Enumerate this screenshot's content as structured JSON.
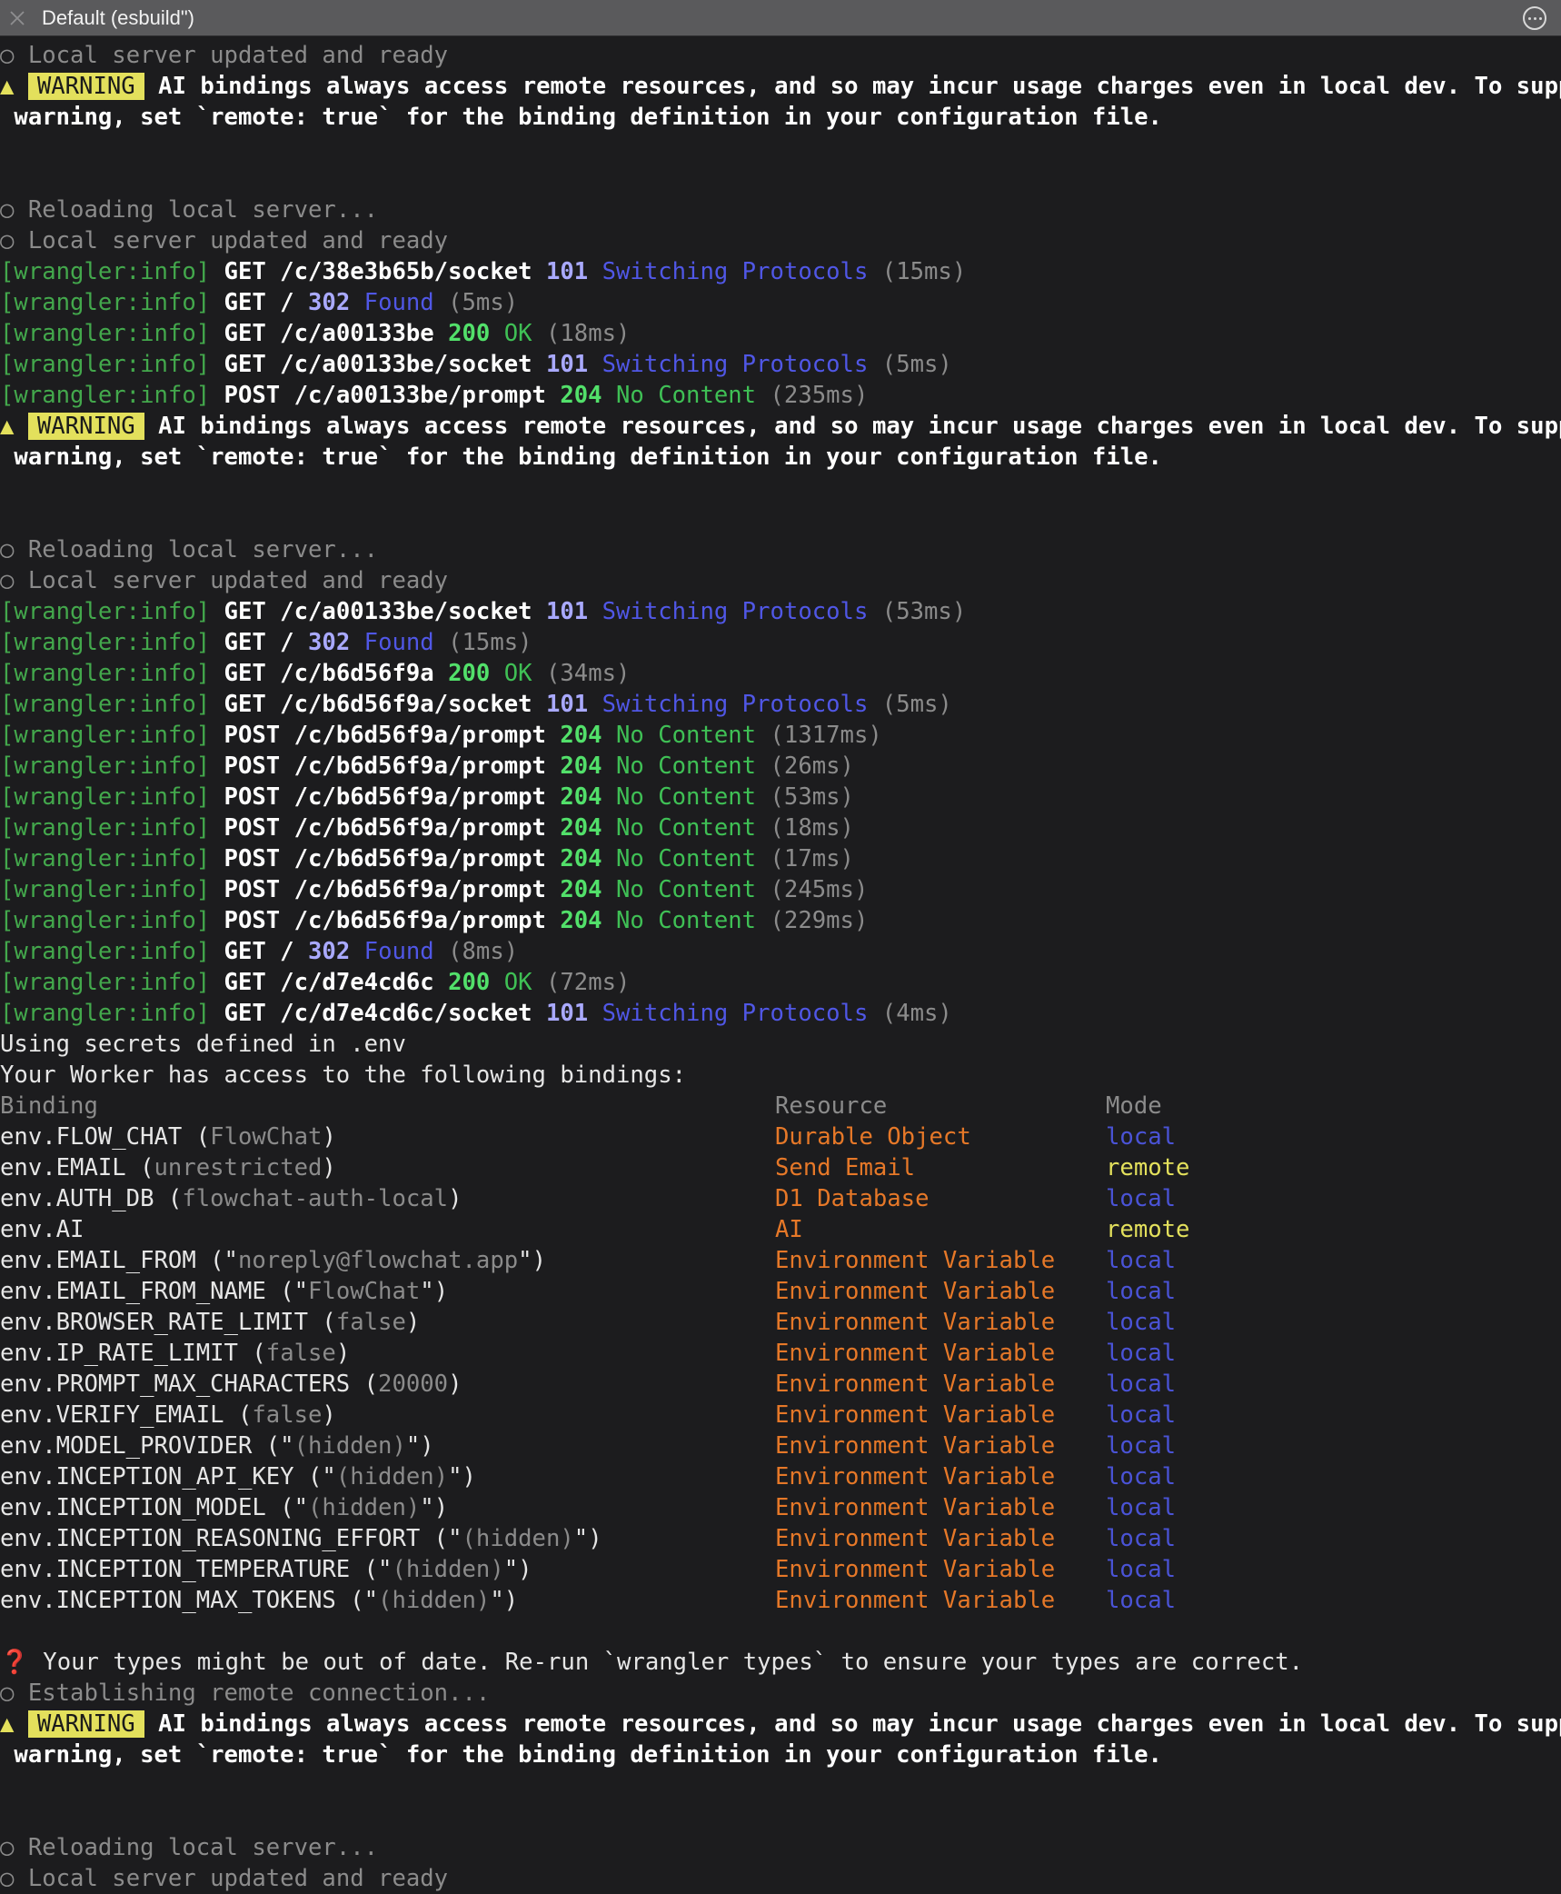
{
  "window": {
    "title": "Default (esbuild\")"
  },
  "log": {
    "updated": "Local server updated and ready",
    "reloading": "Reloading local server...",
    "establishing": "Establishing remote connection...",
    "circle": "○",
    "warning_triangle": "▲",
    "warning_badge": "WARNING",
    "warning_line1": "AI bindings always access remote resources, and so may incur usage charges even in local dev. To suppress this",
    "warning_line2": "warning, set `remote: true` for the binding definition in your configuration file.",
    "prefix": "[wrangler:info]",
    "requests": [
      {
        "method": "GET",
        "path": "/c/38e3b65b/socket",
        "code": "101",
        "text": "Switching Protocols",
        "time": "(15ms)"
      },
      {
        "method": "GET",
        "path": "/",
        "code": "302",
        "text": "Found",
        "time": "(5ms)"
      },
      {
        "method": "GET",
        "path": "/c/a00133be",
        "code": "200",
        "text": "OK",
        "time": "(18ms)"
      },
      {
        "method": "GET",
        "path": "/c/a00133be/socket",
        "code": "101",
        "text": "Switching Protocols",
        "time": "(5ms)"
      },
      {
        "method": "POST",
        "path": "/c/a00133be/prompt",
        "code": "204",
        "text": "No Content",
        "time": "(235ms)"
      },
      {
        "method": "GET",
        "path": "/c/a00133be/socket",
        "code": "101",
        "text": "Switching Protocols",
        "time": "(53ms)"
      },
      {
        "method": "GET",
        "path": "/",
        "code": "302",
        "text": "Found",
        "time": "(15ms)"
      },
      {
        "method": "GET",
        "path": "/c/b6d56f9a",
        "code": "200",
        "text": "OK",
        "time": "(34ms)"
      },
      {
        "method": "GET",
        "path": "/c/b6d56f9a/socket",
        "code": "101",
        "text": "Switching Protocols",
        "time": "(5ms)"
      },
      {
        "method": "POST",
        "path": "/c/b6d56f9a/prompt",
        "code": "204",
        "text": "No Content",
        "time": "(1317ms)"
      },
      {
        "method": "POST",
        "path": "/c/b6d56f9a/prompt",
        "code": "204",
        "text": "No Content",
        "time": "(26ms)"
      },
      {
        "method": "POST",
        "path": "/c/b6d56f9a/prompt",
        "code": "204",
        "text": "No Content",
        "time": "(53ms)"
      },
      {
        "method": "POST",
        "path": "/c/b6d56f9a/prompt",
        "code": "204",
        "text": "No Content",
        "time": "(18ms)"
      },
      {
        "method": "POST",
        "path": "/c/b6d56f9a/prompt",
        "code": "204",
        "text": "No Content",
        "time": "(17ms)"
      },
      {
        "method": "POST",
        "path": "/c/b6d56f9a/prompt",
        "code": "204",
        "text": "No Content",
        "time": "(245ms)"
      },
      {
        "method": "POST",
        "path": "/c/b6d56f9a/prompt",
        "code": "204",
        "text": "No Content",
        "time": "(229ms)"
      },
      {
        "method": "GET",
        "path": "/",
        "code": "302",
        "text": "Found",
        "time": "(8ms)"
      },
      {
        "method": "GET",
        "path": "/c/d7e4cd6c",
        "code": "200",
        "text": "OK",
        "time": "(72ms)"
      },
      {
        "method": "GET",
        "path": "/c/d7e4cd6c/socket",
        "code": "101",
        "text": "Switching Protocols",
        "time": "(4ms)"
      }
    ],
    "secrets": "Using secrets defined in .env",
    "bindings_intro": "Your Worker has access to the following bindings:",
    "headers": {
      "binding": "Binding",
      "resource": "Resource",
      "mode": "Mode"
    },
    "bindings": [
      {
        "name": "env.FLOW_CHAT",
        "open": " (",
        "value": "FlowChat",
        "close": ")",
        "resource": "Durable Object",
        "mode": "local"
      },
      {
        "name": "env.EMAIL",
        "open": " (",
        "value": "unrestricted",
        "close": ")",
        "resource": "Send Email",
        "mode": "remote"
      },
      {
        "name": "env.AUTH_DB",
        "open": " (",
        "value": "flowchat-auth-local",
        "close": ")",
        "resource": "D1 Database",
        "mode": "local"
      },
      {
        "name": "env.AI",
        "open": "",
        "value": "",
        "close": "",
        "resource": "AI",
        "mode": "remote"
      },
      {
        "name": "env.EMAIL_FROM",
        "open": " (\"",
        "value": "noreply@flowchat.app",
        "close": "\")",
        "resource": "Environment Variable",
        "mode": "local"
      },
      {
        "name": "env.EMAIL_FROM_NAME",
        "open": " (\"",
        "value": "FlowChat",
        "close": "\")",
        "resource": "Environment Variable",
        "mode": "local"
      },
      {
        "name": "env.BROWSER_RATE_LIMIT",
        "open": " (",
        "value": "false",
        "close": ")",
        "resource": "Environment Variable",
        "mode": "local"
      },
      {
        "name": "env.IP_RATE_LIMIT",
        "open": " (",
        "value": "false",
        "close": ")",
        "resource": "Environment Variable",
        "mode": "local"
      },
      {
        "name": "env.PROMPT_MAX_CHARACTERS",
        "open": " (",
        "value": "20000",
        "close": ")",
        "resource": "Environment Variable",
        "mode": "local"
      },
      {
        "name": "env.VERIFY_EMAIL",
        "open": " (",
        "value": "false",
        "close": ")",
        "resource": "Environment Variable",
        "mode": "local"
      },
      {
        "name": "env.MODEL_PROVIDER",
        "open": " (\"",
        "value": "(hidden)",
        "close": "\")",
        "resource": "Environment Variable",
        "mode": "local"
      },
      {
        "name": "env.INCEPTION_API_KEY",
        "open": " (\"",
        "value": "(hidden)",
        "close": "\")",
        "resource": "Environment Variable",
        "mode": "local"
      },
      {
        "name": "env.INCEPTION_MODEL",
        "open": " (\"",
        "value": "(hidden)",
        "close": "\")",
        "resource": "Environment Variable",
        "mode": "local"
      },
      {
        "name": "env.INCEPTION_REASONING_EFFORT",
        "open": " (\"",
        "value": "(hidden)",
        "close": "\")",
        "resource": "Environment Variable",
        "mode": "local"
      },
      {
        "name": "env.INCEPTION_TEMPERATURE",
        "open": " (\"",
        "value": "(hidden)",
        "close": "\")",
        "resource": "Environment Variable",
        "mode": "local"
      },
      {
        "name": "env.INCEPTION_MAX_TOKENS",
        "open": " (\"",
        "value": "(hidden)",
        "close": "\")",
        "resource": "Environment Variable",
        "mode": "local"
      }
    ],
    "types_mark": "❓",
    "types_msg": "Your types might be out of date. Re-run `wrangler types` to ensure your types are correct."
  },
  "colors": {
    "background": "#1c1c1e",
    "wrangler_prefix": "#43a84c",
    "status_code_blue": "#a9a9ff",
    "status_code_green": "#52e06a",
    "resource_orange": "#e67828",
    "mode_local": "#4a53d6",
    "mode_remote": "#e3e05c",
    "warning_yellow": "#e3e05c"
  },
  "icons": {
    "close": "close-icon",
    "more": "more-icon"
  }
}
